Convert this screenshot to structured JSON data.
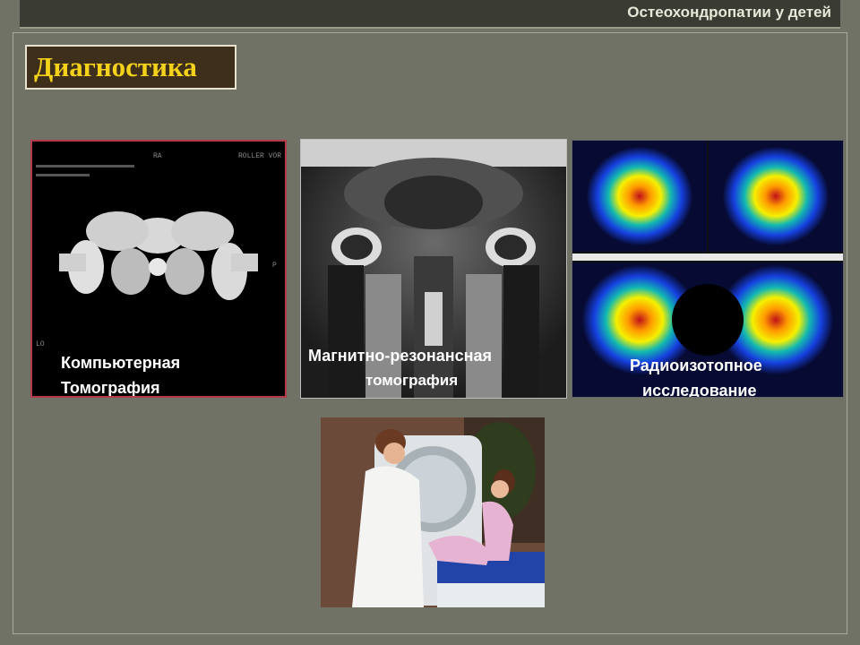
{
  "header": {
    "title": "Остеохондропатии у детей"
  },
  "slide": {
    "title": "Диагностика"
  },
  "panels": [
    {
      "caption_line1": "Компьютерная",
      "caption_line2": "Томография"
    },
    {
      "caption_line1": "Магнитно-резонансная",
      "caption_line2": "томография"
    },
    {
      "caption_line1": "Радиоизотопное",
      "caption_line2": "исследование"
    }
  ],
  "colors": {
    "background": "#6f7265",
    "title_text": "#f5d21a",
    "title_box": "#3e2f1a",
    "caption_text": "#ffffff"
  },
  "ct_overlay": {
    "top_right": "ROLLER VOR",
    "top_mid": "RA",
    "side_right": "P",
    "bottom_left": "LO"
  }
}
